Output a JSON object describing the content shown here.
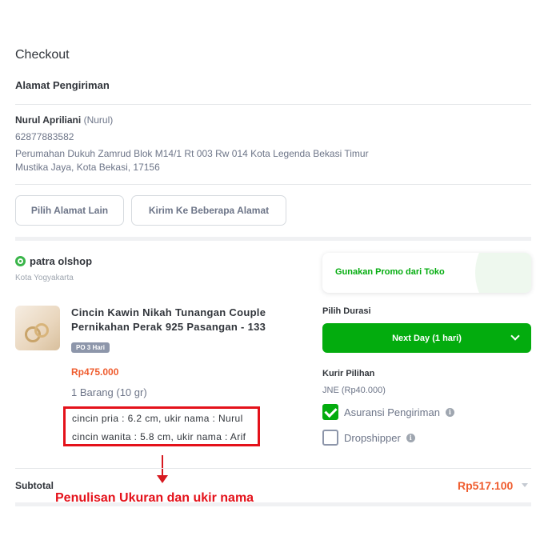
{
  "page": {
    "title": "Checkout"
  },
  "shipping": {
    "section_title": "Alamat Pengiriman",
    "recipient_name": "Nurul Apriliani",
    "recipient_nick": "(Nurul)",
    "phone": "62877883582",
    "address_line1": "Perumahan Dukuh Zamrud Blok M14/1 Rt 003 Rw 014 Kota Legenda Bekasi Timur",
    "address_line2": "Mustika Jaya, Kota Bekasi, 17156",
    "choose_other_label": "Pilih Alamat Lain",
    "multi_address_label": "Kirim Ke Beberapa Alamat"
  },
  "shop": {
    "name": "patra olshop",
    "city": "Kota Yogyakarta",
    "promo_label": "Gunakan Promo dari Toko"
  },
  "product": {
    "title": "Cincin Kawin Nikah Tunangan Couple Pernikahan Perak 925 Pasangan - 133",
    "badge": "PO 3 Hari",
    "price": "Rp475.000",
    "quantity": "1 Barang (10 gr)",
    "note_line1": "cincin pria : 6.2 cm, ukir nama : Nurul",
    "note_line2": "cincin wanita : 5.8 cm, ukir nama : Arif"
  },
  "delivery": {
    "duration_label": "Pilih Durasi",
    "duration_value": "Next Day (1 hari)",
    "courier_label": "Kurir Pilihan",
    "courier_value": "JNE (Rp40.000)",
    "insurance_label": "Asuransi Pengiriman",
    "insurance_checked": true,
    "dropshipper_label": "Dropshipper",
    "dropshipper_checked": false
  },
  "summary": {
    "subtotal_label": "Subtotal",
    "subtotal_value": "Rp517.100"
  },
  "annotation": {
    "caption": "Penulisan Ukuran dan ukir nama",
    "color": "#e4111a"
  },
  "colors": {
    "primary_green": "#03ac0e",
    "price_orange": "#ef5c2e"
  },
  "icons": [
    "shop-badge-icon",
    "chevron-down-icon",
    "check-icon",
    "info-icon",
    "arrow-down-icon"
  ]
}
